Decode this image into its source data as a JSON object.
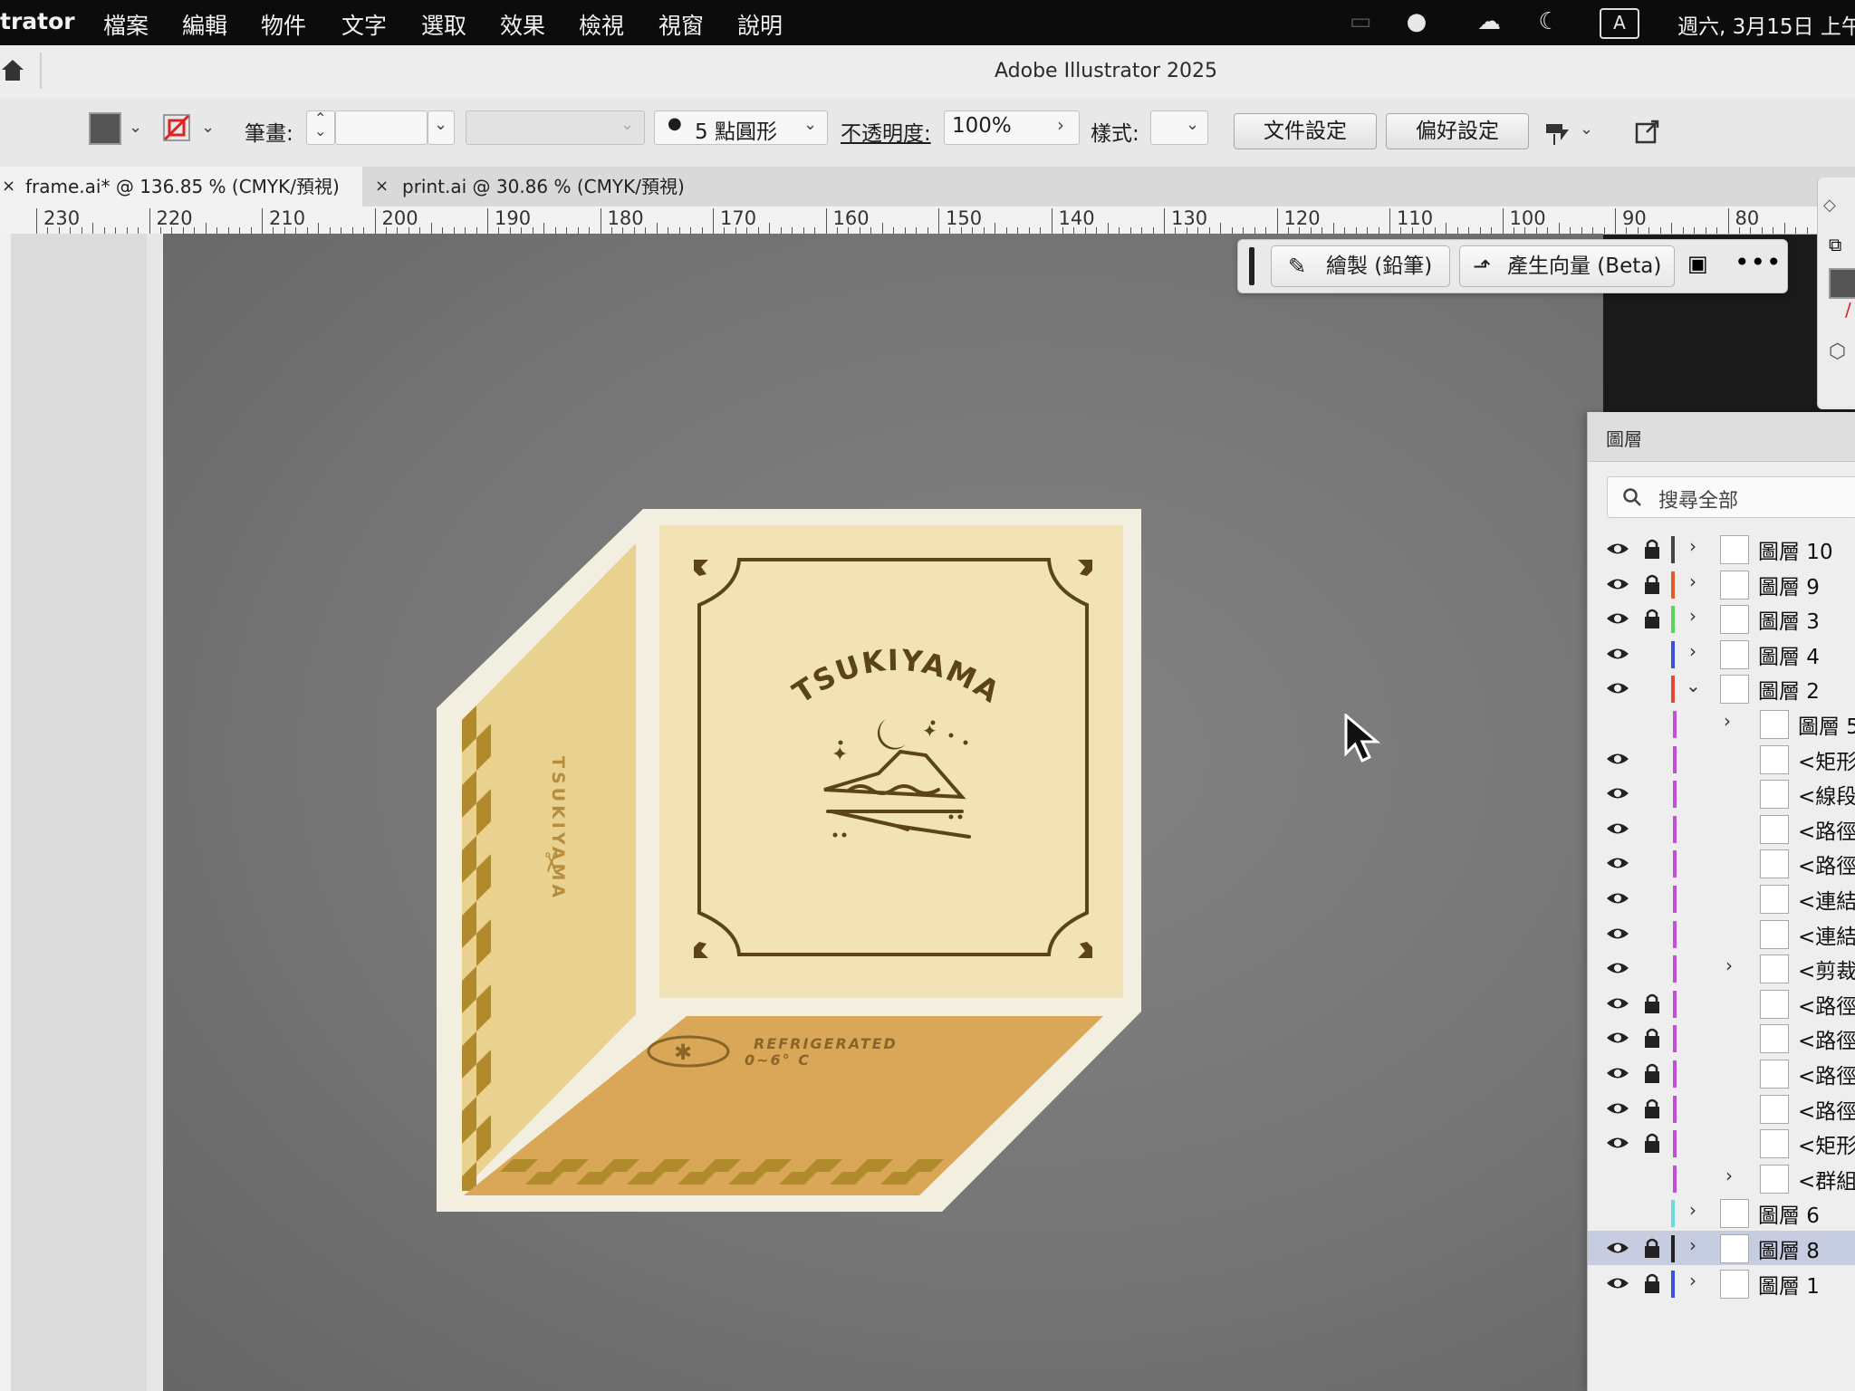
{
  "menubar": {
    "app_partial": "trator",
    "items": [
      "檔案",
      "編輯",
      "物件",
      "文字",
      "選取",
      "效果",
      "檢視",
      "視窗",
      "說明"
    ],
    "clock": "週六, 3月15日 上午"
  },
  "titlebar": {
    "title": "Adobe Illustrator 2025"
  },
  "controlbar": {
    "stroke_label": "筆畫:",
    "brush_value": "5 點圓形",
    "opacity_label": "不透明度:",
    "opacity_value": "100%",
    "style_label": "樣式:",
    "doc_setup_button": "文件設定",
    "prefs_button": "偏好設定"
  },
  "tabs": [
    {
      "label": "frame.ai* @ 136.85 % (CMYK/預視)",
      "active": true
    },
    {
      "label": "print.ai @ 30.86 % (CMYK/預視)",
      "active": false
    }
  ],
  "ruler": {
    "labels": [
      "230",
      "220",
      "210",
      "200",
      "190",
      "180",
      "170",
      "160",
      "150",
      "140",
      "130",
      "120",
      "110",
      "100",
      "90",
      "80"
    ]
  },
  "context_bar": {
    "draw_button": "繪製 (鉛筆)",
    "generate_button": "產生向量 (Beta)"
  },
  "artwork": {
    "brand": "TSUKIYAMA",
    "side_text": "TSUKIYAMA",
    "label_line1": "REFRIGERATED",
    "label_line2": "0~6° C",
    "colors": {
      "outline": "#f3efe0",
      "front": "#f1e3b6",
      "side": "#e9d18f",
      "bottom": "#d9a757",
      "ink": "#5b4415",
      "check": "#b18a2c"
    }
  },
  "layers_panel": {
    "title": "圖層",
    "search_placeholder": "搜尋全部",
    "rows": [
      {
        "name": "圖層 10",
        "eye": true,
        "lock": true,
        "color": "#444444",
        "expand": "right",
        "indent": 0
      },
      {
        "name": "圖層 9",
        "eye": true,
        "lock": true,
        "color": "#e35a2b",
        "expand": "right",
        "indent": 0
      },
      {
        "name": "圖層 3",
        "eye": true,
        "lock": true,
        "color": "#5bd35b",
        "expand": "right",
        "indent": 0
      },
      {
        "name": "圖層 4",
        "eye": true,
        "lock": false,
        "color": "#3b4fd8",
        "expand": "right",
        "indent": 0
      },
      {
        "name": "圖層 2",
        "eye": true,
        "lock": false,
        "color": "#e14a3a",
        "expand": "down",
        "indent": 0
      },
      {
        "name": "圖層 5",
        "eye": false,
        "lock": false,
        "color": "#c34fd8",
        "expand": "right",
        "indent": 1
      },
      {
        "name": "<矩形",
        "eye": true,
        "lock": false,
        "color": "#c34fd8",
        "expand": "",
        "indent": 2
      },
      {
        "name": "<線段",
        "eye": true,
        "lock": false,
        "color": "#c34fd8",
        "expand": "",
        "indent": 2
      },
      {
        "name": "<路徑",
        "eye": true,
        "lock": false,
        "color": "#c34fd8",
        "expand": "",
        "indent": 2
      },
      {
        "name": "<路徑",
        "eye": true,
        "lock": false,
        "color": "#c34fd8",
        "expand": "",
        "indent": 2
      },
      {
        "name": "<連結",
        "eye": true,
        "lock": false,
        "color": "#c34fd8",
        "expand": "",
        "indent": 2
      },
      {
        "name": "<連結",
        "eye": true,
        "lock": false,
        "color": "#c34fd8",
        "expand": "",
        "indent": 2
      },
      {
        "name": "<剪裁",
        "eye": true,
        "lock": false,
        "color": "#c34fd8",
        "expand": "right",
        "indent": 2
      },
      {
        "name": "<路徑",
        "eye": true,
        "lock": true,
        "color": "#c34fd8",
        "expand": "",
        "indent": 2
      },
      {
        "name": "<路徑",
        "eye": true,
        "lock": true,
        "color": "#c34fd8",
        "expand": "",
        "indent": 2
      },
      {
        "name": "<路徑",
        "eye": true,
        "lock": true,
        "color": "#c34fd8",
        "expand": "",
        "indent": 2
      },
      {
        "name": "<路徑",
        "eye": true,
        "lock": true,
        "color": "#c34fd8",
        "expand": "",
        "indent": 2
      },
      {
        "name": "<矩形",
        "eye": true,
        "lock": true,
        "color": "#c34fd8",
        "expand": "",
        "indent": 2
      },
      {
        "name": "<群組",
        "eye": false,
        "lock": false,
        "color": "#c34fd8",
        "expand": "right",
        "indent": 2
      },
      {
        "name": "圖層 6",
        "eye": false,
        "lock": false,
        "color": "#6fd9d9",
        "expand": "right",
        "indent": 0
      },
      {
        "name": "圖層 8",
        "eye": true,
        "lock": true,
        "color": "#222222",
        "expand": "right",
        "indent": 0,
        "selected": true
      },
      {
        "name": "圖層 1",
        "eye": true,
        "lock": true,
        "color": "#3b4fd8",
        "expand": "right",
        "indent": 0
      }
    ]
  }
}
